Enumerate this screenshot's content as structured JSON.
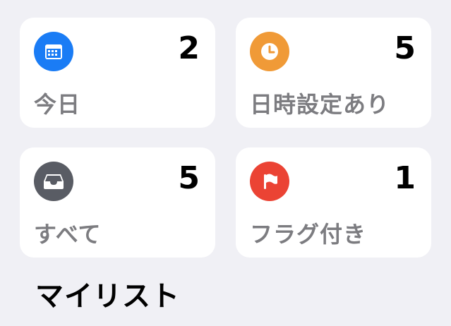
{
  "smart_lists": [
    {
      "label": "今日",
      "count": "2",
      "icon": "calendar-icon",
      "color": "#1a7cf5"
    },
    {
      "label": "日時設定あり",
      "count": "5",
      "icon": "clock-icon",
      "color": "#f09a37"
    },
    {
      "label": "すべて",
      "count": "5",
      "icon": "tray-icon",
      "color": "#595c64"
    },
    {
      "label": "フラグ付き",
      "count": "1",
      "icon": "flag-icon",
      "color": "#eb4334"
    }
  ],
  "section": {
    "title": "マイリスト"
  },
  "colors": {
    "background": "#f0f0f5",
    "card": "#ffffff",
    "label": "#7c7c80"
  }
}
